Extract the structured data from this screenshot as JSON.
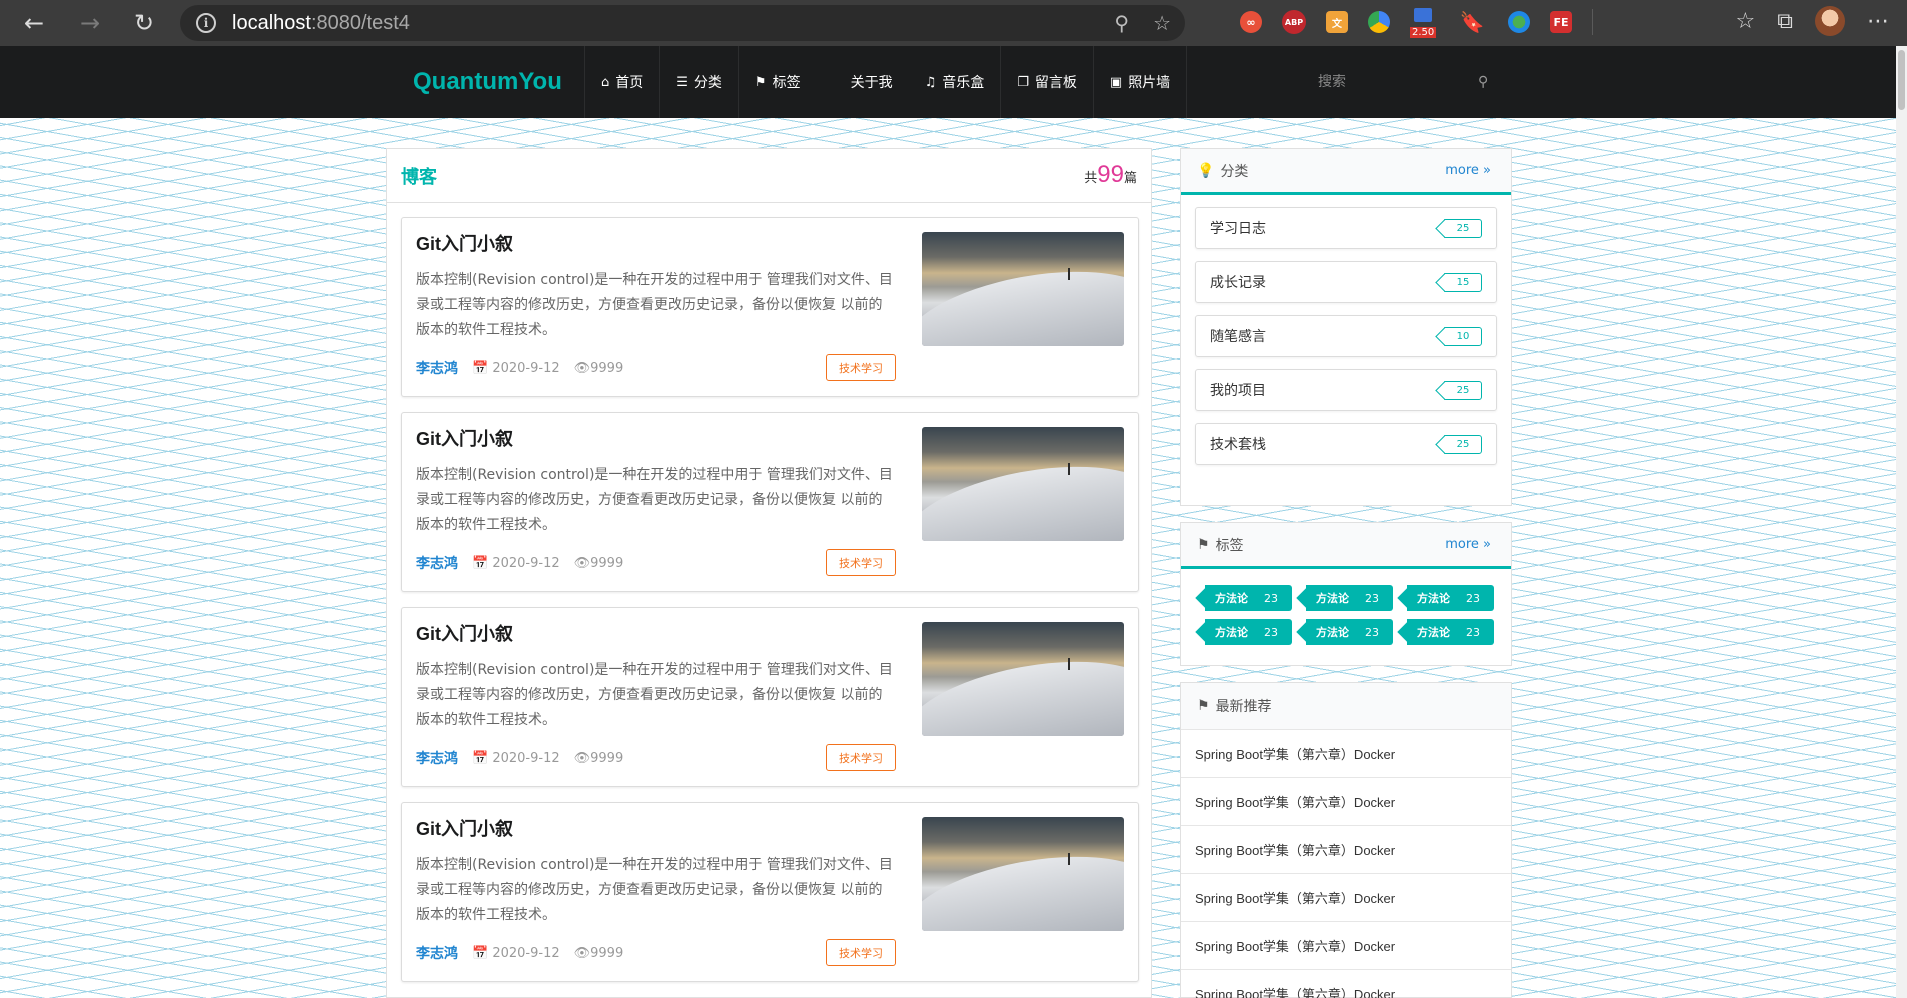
{
  "browser": {
    "url_host": "localhost",
    "url_rest": ":8080/test4",
    "extension_badge": "2.50"
  },
  "site": {
    "brand": "QuantumYou",
    "menu": [
      {
        "label": "首页",
        "icon": "home-icon"
      },
      {
        "label": "分类",
        "icon": "list-icon"
      },
      {
        "label": "标签",
        "icon": "tags-icon"
      },
      {
        "label": "关于我",
        "icon": ""
      },
      {
        "label": "音乐盒",
        "icon": "music-icon"
      },
      {
        "label": "留言板",
        "icon": "paste-icon"
      },
      {
        "label": "照片墙",
        "icon": "image-icon"
      }
    ],
    "search_placeholder": "搜索"
  },
  "main": {
    "title": "博客",
    "count_prefix": "共",
    "count": "99",
    "count_suffix": "篇",
    "posts": [
      {
        "title": "Git入门小叙",
        "summary": "版本控制(Revision control)是一种在开发的过程中用于 管理我们对文件、目录或工程等内容的修改历史，方便查看更改历史记录，备份以便恢复 以前的版本的软件工程技术。",
        "author": "李志鸿",
        "date": "2020-9-12",
        "views": "9999",
        "tag": "技术学习"
      },
      {
        "title": "Git入门小叙",
        "summary": "版本控制(Revision control)是一种在开发的过程中用于 管理我们对文件、目录或工程等内容的修改历史，方便查看更改历史记录，备份以便恢复 以前的版本的软件工程技术。",
        "author": "李志鸿",
        "date": "2020-9-12",
        "views": "9999",
        "tag": "技术学习"
      },
      {
        "title": "Git入门小叙",
        "summary": "版本控制(Revision control)是一种在开发的过程中用于 管理我们对文件、目录或工程等内容的修改历史，方便查看更改历史记录，备份以便恢复 以前的版本的软件工程技术。",
        "author": "李志鸿",
        "date": "2020-9-12",
        "views": "9999",
        "tag": "技术学习"
      },
      {
        "title": "Git入门小叙",
        "summary": "版本控制(Revision control)是一种在开发的过程中用于 管理我们对文件、目录或工程等内容的修改历史，方便查看更改历史记录，备份以便恢复 以前的版本的软件工程技术。",
        "author": "李志鸿",
        "date": "2020-9-12",
        "views": "9999",
        "tag": "技术学习"
      }
    ]
  },
  "sidebar": {
    "categories": {
      "title": "分类",
      "more": "more",
      "items": [
        {
          "label": "学习日志",
          "count": "25"
        },
        {
          "label": "成长记录",
          "count": "15"
        },
        {
          "label": "随笔感言",
          "count": "10"
        },
        {
          "label": "我的项目",
          "count": "25"
        },
        {
          "label": "技术套栈",
          "count": "25"
        }
      ]
    },
    "tags": {
      "title": "标签",
      "more": "more",
      "items": [
        {
          "label": "方法论",
          "count": "23"
        },
        {
          "label": "方法论",
          "count": "23"
        },
        {
          "label": "方法论",
          "count": "23"
        },
        {
          "label": "方法论",
          "count": "23"
        },
        {
          "label": "方法论",
          "count": "23"
        },
        {
          "label": "方法论",
          "count": "23"
        }
      ]
    },
    "recommend": {
      "title": "最新推荐",
      "items": [
        "Spring Boot学集（第六章）Docker",
        "Spring Boot学集（第六章）Docker",
        "Spring Boot学集（第六章）Docker",
        "Spring Boot学集（第六章）Docker",
        "Spring Boot学集（第六章）Docker",
        "Spring Boot学集（第六章）Docker"
      ]
    }
  },
  "colors": {
    "brand": "#00b5ad",
    "count": "#e03997",
    "author": "#2185d0",
    "tag_border": "#f2711c"
  }
}
